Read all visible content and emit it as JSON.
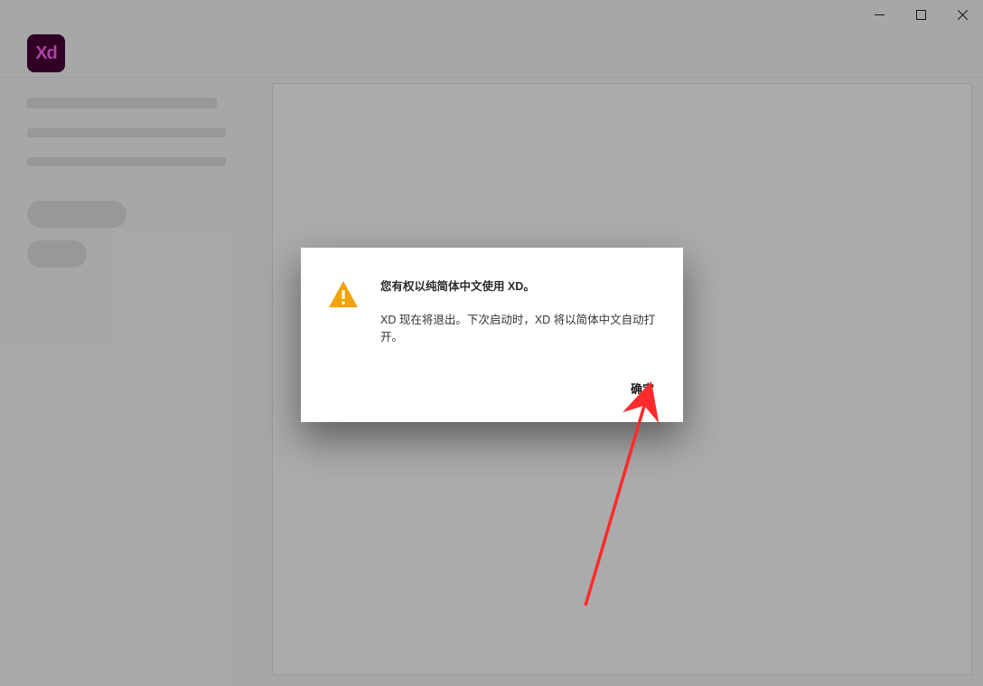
{
  "app": {
    "logo_text": "Xd"
  },
  "window_controls": {
    "minimize": "minimize",
    "maximize": "maximize",
    "close": "close"
  },
  "dialog": {
    "title": "您有权以纯简体中文使用 XD。",
    "body": "XD 现在将退出。下次启动时，XD 将以简体中文自动打开。",
    "ok_label": "确定"
  },
  "colors": {
    "xd_bg": "#470137",
    "xd_fg": "#FF61F6",
    "warning": "#F0A30A",
    "arrow": "#FF2A2A"
  }
}
